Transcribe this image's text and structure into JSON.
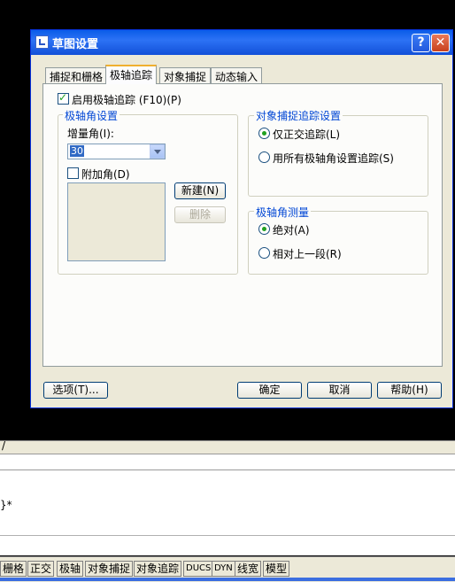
{
  "dialog": {
    "title": "草图设置",
    "help_glyph": "?",
    "close_glyph": "✕"
  },
  "tabs": [
    {
      "label": "捕捉和栅格",
      "active": false
    },
    {
      "label": "极轴追踪",
      "active": true
    },
    {
      "label": "对象捕捉",
      "active": false
    },
    {
      "label": "动态输入",
      "active": false
    }
  ],
  "polar": {
    "enable_label": "启用极轴追踪 (F10)(P)",
    "enable_checked": true,
    "angle_group_title": "极轴角设置",
    "increment_label": "增量角(I):",
    "increment_value": "30",
    "additional_label": "附加角(D)",
    "additional_checked": false,
    "new_button": "新建(N)",
    "delete_button": "删除",
    "osnap_group_title": "对象捕捉追踪设置",
    "ortho_only_label": "仅正交追踪(L)",
    "all_angles_label": "用所有极轴角设置追踪(S)",
    "measure_group_title": "极轴角测量",
    "absolute_label": "绝对(A)",
    "relative_label": "相对上一段(R)"
  },
  "footer": {
    "options_button": "选项(T)...",
    "ok_button": "确定",
    "cancel_button": "取消",
    "help_button": "帮助(H)"
  },
  "command": {
    "strip_text": "/",
    "line_text": "}*"
  },
  "status_buttons": [
    "栅格",
    "正交",
    "极轴",
    "对象捕捉",
    "对象追踪",
    "DUCS",
    "DYN",
    "线宽",
    "模型"
  ],
  "colors": {
    "title_bar": "#0a5ce8",
    "group_title": "#0046d5",
    "active_tab_accent": "#f0b030",
    "check_mark": "#21a121"
  },
  "icons": {
    "app": "drafting-settings-icon",
    "help": "question-icon",
    "close": "close-icon",
    "dropdown": "chevron-down-icon"
  }
}
